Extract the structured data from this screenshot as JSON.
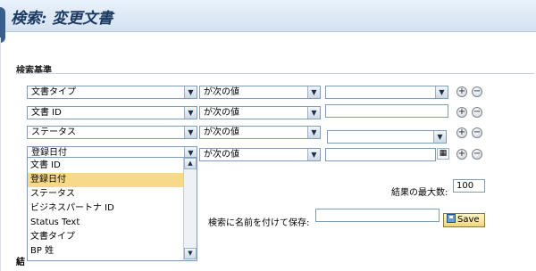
{
  "header": {
    "title": "検索: 変更文書"
  },
  "section": {
    "label": "検索基準"
  },
  "criteria": [
    {
      "field": "文書タイプ",
      "operator": "が次の値",
      "value": "",
      "value_type": "select"
    },
    {
      "field": "文書 ID",
      "operator": "が次の値",
      "value": "",
      "value_type": "text"
    },
    {
      "field": "ステータス",
      "operator": "が次の値",
      "value": "",
      "value_type": "select"
    },
    {
      "field": "登録日付",
      "operator": "が次の値",
      "value": "",
      "value_type": "date"
    }
  ],
  "buttons": {
    "add": "+",
    "remove": "−"
  },
  "dropdown": {
    "options": [
      "文書 ID",
      "登録日付",
      "ステータス",
      "ビジネスパートナ ID",
      "Status Text",
      "文書タイプ",
      "BP 姓"
    ],
    "selected_index": 1
  },
  "max_results": {
    "label": "結果の最大数:",
    "value": "100"
  },
  "save_search": {
    "label": "検索に名前を付けて保存:",
    "value": "",
    "button": "Save"
  },
  "bottom": {
    "label": "結"
  },
  "colors": {
    "header": "#d4e2f1",
    "title": "#1d3a63",
    "selected_row": "#f7d98a",
    "save_button": "#f1d57d"
  }
}
